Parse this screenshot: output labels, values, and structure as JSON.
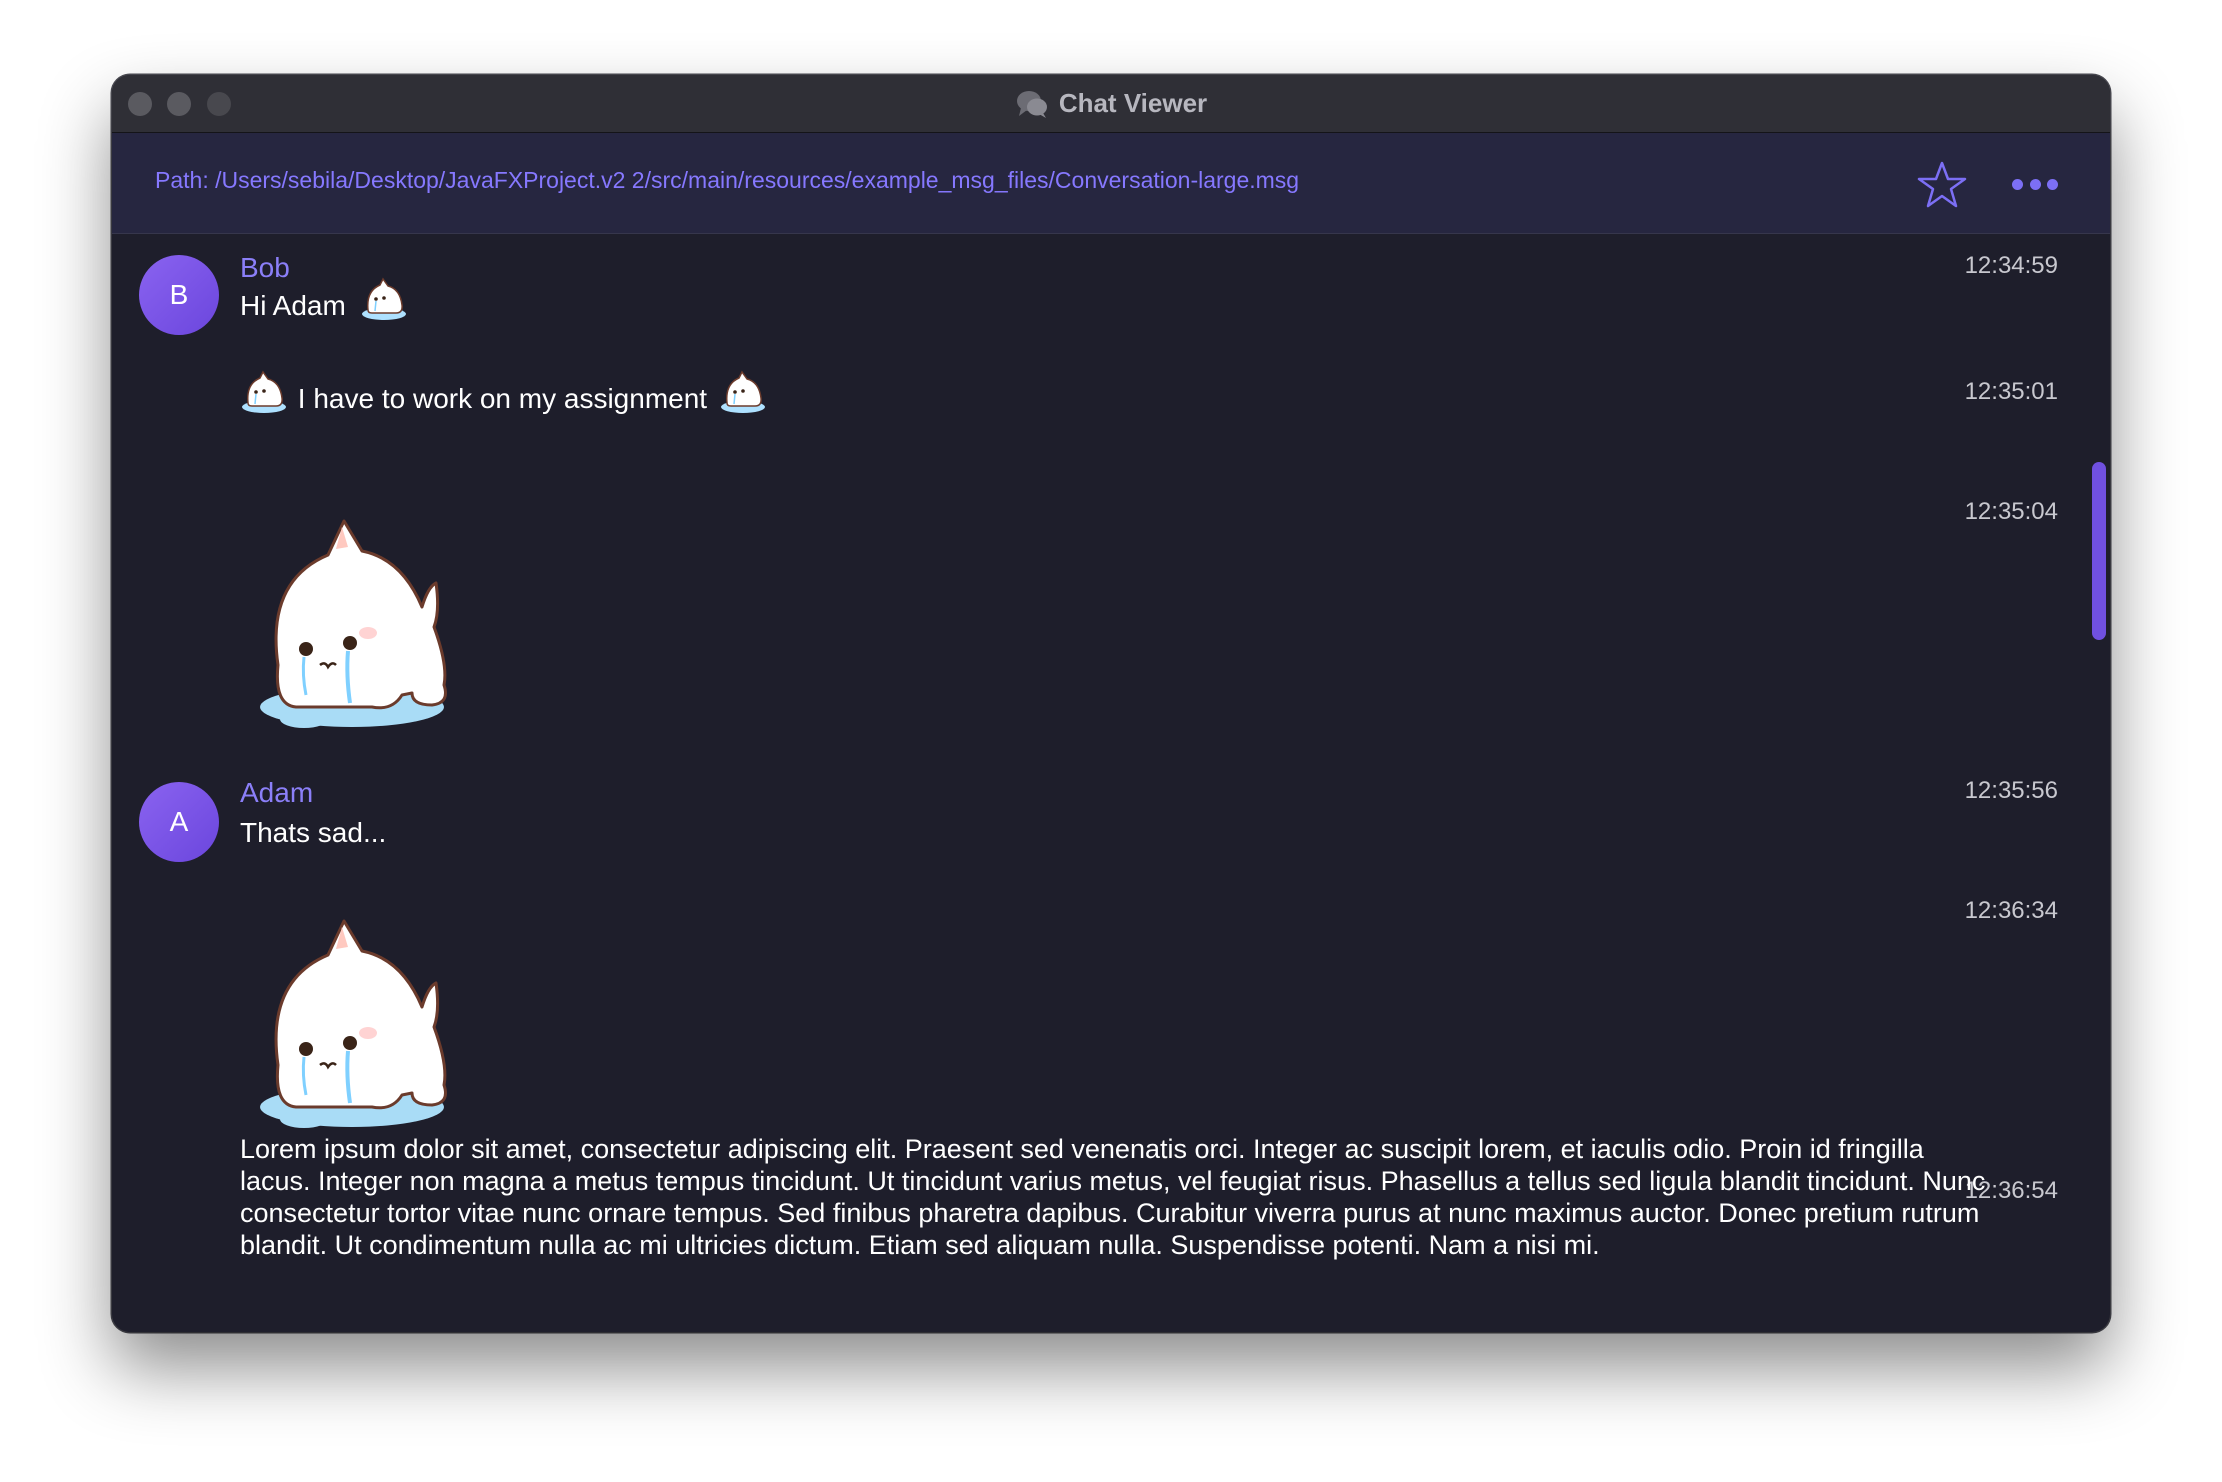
{
  "window": {
    "title": "Chat Viewer",
    "title_icon": "chat-bubbles-icon"
  },
  "header": {
    "path_text": "Path: /Users/sebila/Desktop/JavaFXProject.v2 2/src/main/resources/example_msg_files/Conversation-large.msg",
    "star_icon": "star-icon",
    "more_icon": "more-dots-icon"
  },
  "messages": [
    {
      "sender": "Bob",
      "avatar": "B",
      "text": "Hi Adam",
      "time": "12:34:59"
    },
    {
      "text": "I have to work on my assignment",
      "time": "12:35:01"
    },
    {
      "sticker": "crying-cat-sticker",
      "time": "12:35:04"
    },
    {
      "sender": "Adam",
      "avatar": "A",
      "text": "Thats sad...",
      "time": "12:35:56"
    },
    {
      "sticker": "crying-cat-sticker",
      "time": "12:36:34"
    },
    {
      "text": "Lorem ipsum dolor sit amet, consectetur adipiscing elit. Praesent sed venenatis orci. Integer ac suscipit lorem, et iaculis odio. Proin id fringilla lacus. Integer non magna a metus tempus tincidunt. Ut tincidunt varius metus, vel feugiat risus. Phasellus a tellus sed ligula blandit tincidunt. Nunc consectetur tortor vitae nunc ornare tempus. Sed finibus pharetra dapibus. Curabitur viverra purus at nunc maximus auctor. Donec pretium rutrum blandit. Ut condimentum nulla ac mi ultricies dictum. Etiam sed aliquam nulla. Suspendisse potenti. Nam a nisi mi.",
      "time": "12:36:54"
    }
  ],
  "colors": {
    "accent": "#8678ff",
    "background": "#1e1e2b",
    "header_bg": "#262640",
    "avatar": "#7a55e8",
    "scrollbar": "#7050e0"
  }
}
